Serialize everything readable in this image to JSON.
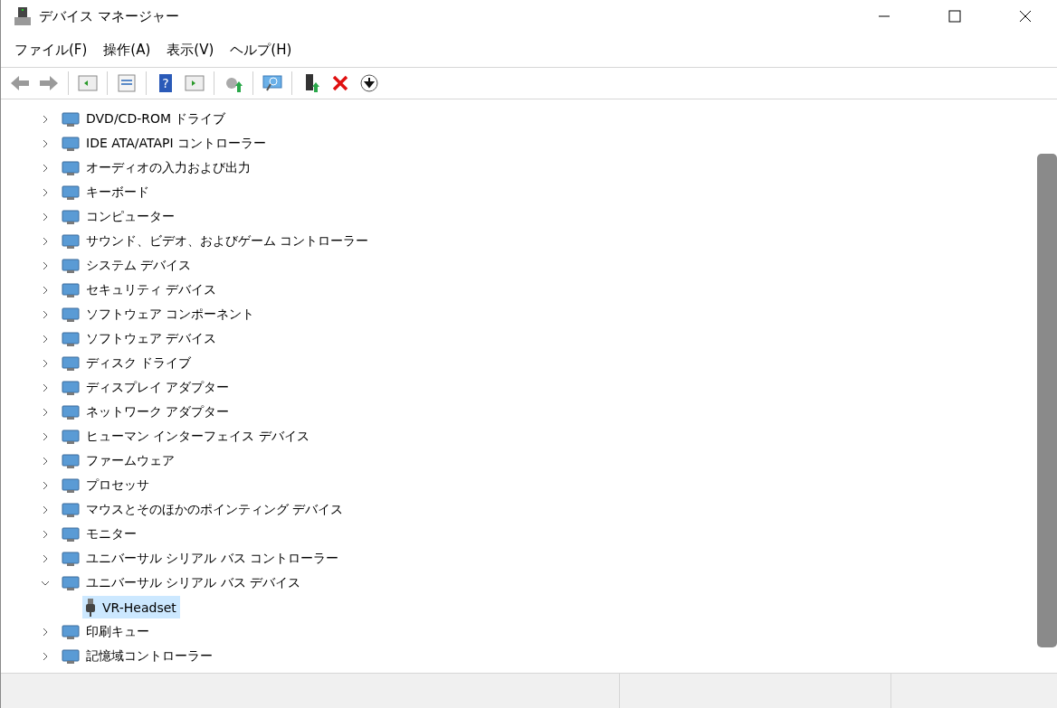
{
  "window": {
    "title": "デバイス マネージャー"
  },
  "toolbar": {
    "help_glyph": "?"
  },
  "menu": [
    {
      "label": "ファイル(F)"
    },
    {
      "label": "操作(A)"
    },
    {
      "label": "表示(V)"
    },
    {
      "label": "ヘルプ(H)"
    }
  ],
  "tree": [
    {
      "label": "DVD/CD-ROM ドライブ",
      "expanded": false
    },
    {
      "label": "IDE ATA/ATAPI コントローラー",
      "expanded": false
    },
    {
      "label": "オーディオの入力および出力",
      "expanded": false
    },
    {
      "label": "キーボード",
      "expanded": false
    },
    {
      "label": "コンピューター",
      "expanded": false
    },
    {
      "label": "サウンド、ビデオ、およびゲーム コントローラー",
      "expanded": false
    },
    {
      "label": "システム デバイス",
      "expanded": false
    },
    {
      "label": "セキュリティ デバイス",
      "expanded": false
    },
    {
      "label": "ソフトウェア コンポーネント",
      "expanded": false
    },
    {
      "label": "ソフトウェア デバイス",
      "expanded": false
    },
    {
      "label": "ディスク ドライブ",
      "expanded": false
    },
    {
      "label": "ディスプレイ アダプター",
      "expanded": false
    },
    {
      "label": "ネットワーク アダプター",
      "expanded": false
    },
    {
      "label": "ヒューマン インターフェイス デバイス",
      "expanded": false
    },
    {
      "label": "ファームウェア",
      "expanded": false
    },
    {
      "label": "プロセッサ",
      "expanded": false
    },
    {
      "label": "マウスとそのほかのポインティング デバイス",
      "expanded": false
    },
    {
      "label": "モニター",
      "expanded": false
    },
    {
      "label": "ユニバーサル シリアル バス コントローラー",
      "expanded": false
    },
    {
      "label": "ユニバーサル シリアル バス デバイス",
      "expanded": true,
      "children": [
        {
          "label": "VR-Headset",
          "selected": true
        }
      ]
    },
    {
      "label": "印刷キュー",
      "expanded": false
    },
    {
      "label": "記憶域コントローラー",
      "expanded": false
    }
  ]
}
